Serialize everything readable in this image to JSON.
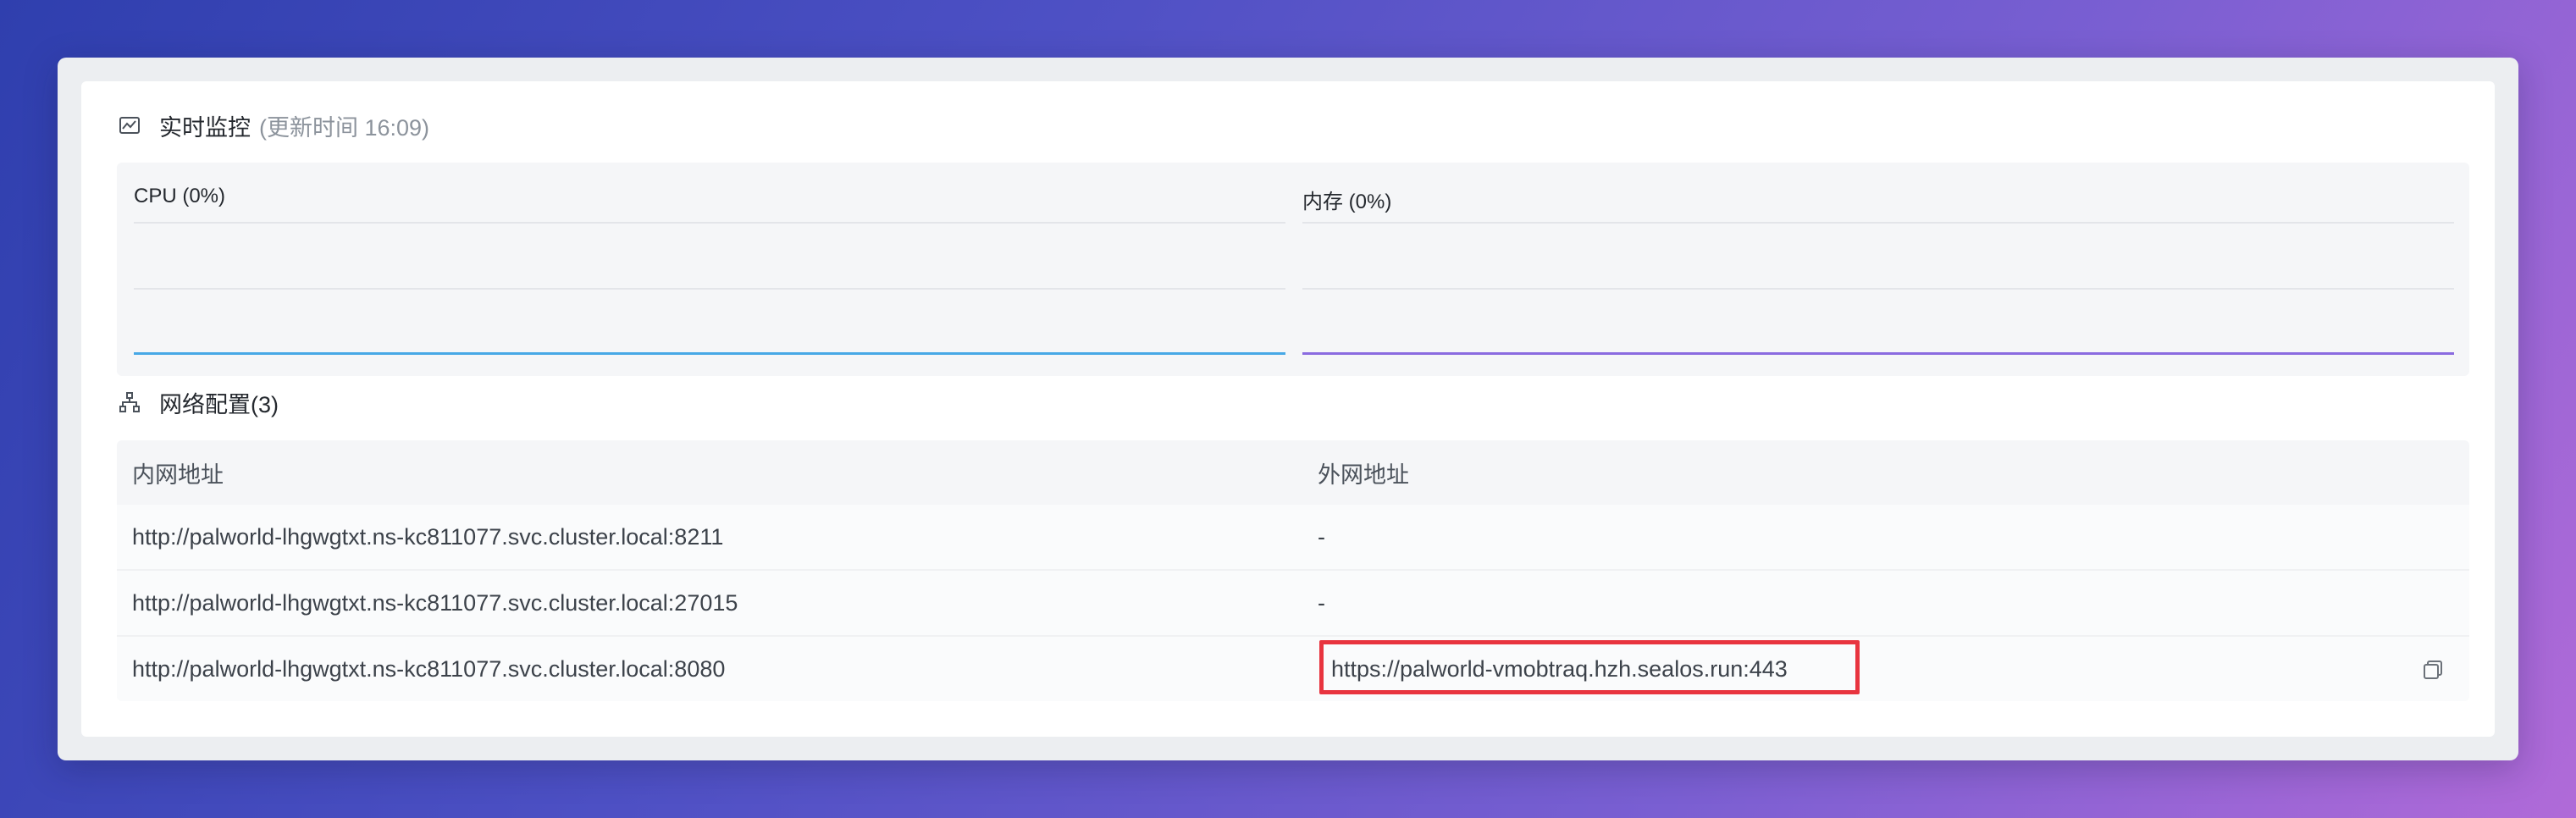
{
  "monitor": {
    "title": "实时监控",
    "update_time": "(更新时间  16:09)",
    "cpu": {
      "label": "CPU  (0%)",
      "value_percent": 0,
      "line_color": "#47a8e6"
    },
    "memory": {
      "label": "内存  (0%)",
      "value_percent": 0,
      "line_color": "#8a6be0"
    }
  },
  "network": {
    "title": "网络配置(3)",
    "columns": {
      "internal": "内网地址",
      "external": "外网地址"
    },
    "rows": [
      {
        "internal": "http://palworld-lhgwgtxt.ns-kc811077.svc.cluster.local:8211",
        "external": "-"
      },
      {
        "internal": "http://palworld-lhgwgtxt.ns-kc811077.svc.cluster.local:27015",
        "external": "-"
      },
      {
        "internal": "http://palworld-lhgwgtxt.ns-kc811077.svc.cluster.local:8080",
        "external": "https://palworld-vmobtraq.hzh.sealos.run:443"
      }
    ]
  },
  "icons": {
    "monitor": "monitor-chart-icon",
    "network": "network-topology-icon",
    "copy": "copy-icon"
  },
  "colors": {
    "highlight_border": "#e8343f"
  }
}
